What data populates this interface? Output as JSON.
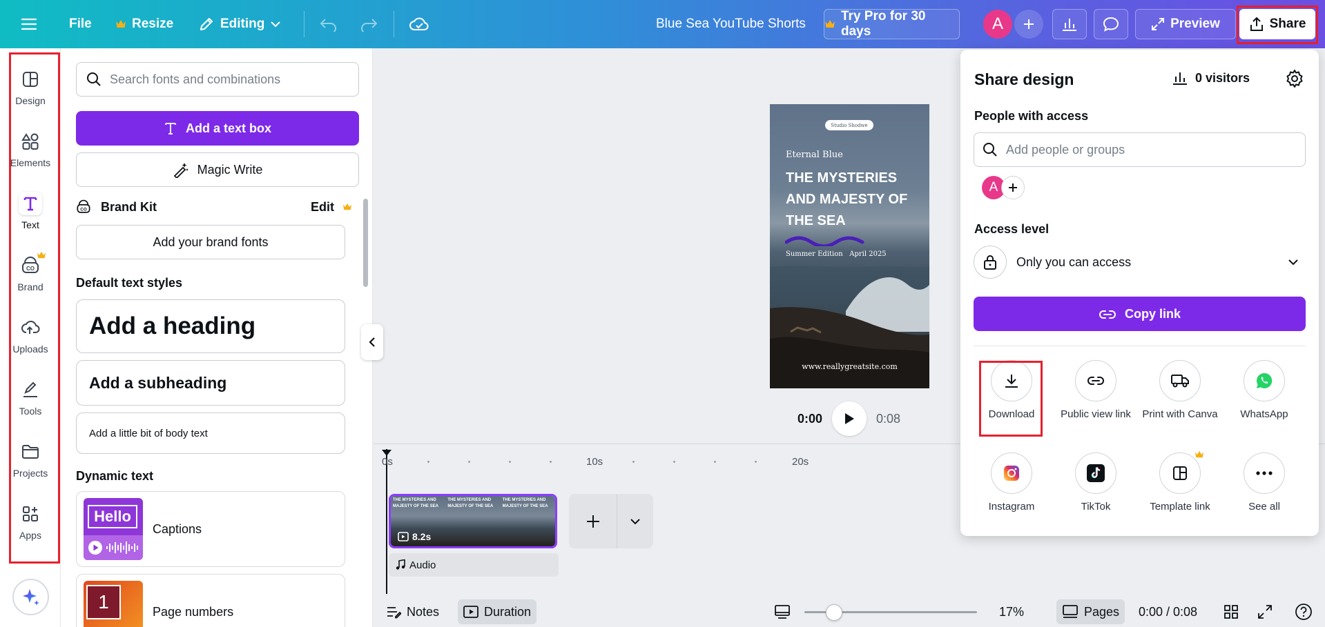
{
  "topbar": {
    "file": "File",
    "resize": "Resize",
    "editing": "Editing",
    "title": "Blue Sea YouTube Shorts",
    "try_pro": "Try Pro for 30 days",
    "avatar_letter": "A",
    "preview": "Preview",
    "share": "Share"
  },
  "rail": {
    "items": [
      {
        "label": "Design",
        "icon": "layout-icon"
      },
      {
        "label": "Elements",
        "icon": "shapes-icon"
      },
      {
        "label": "Text",
        "icon": "text-icon"
      },
      {
        "label": "Brand",
        "icon": "brand-icon"
      },
      {
        "label": "Uploads",
        "icon": "cloud-upload-icon"
      },
      {
        "label": "Tools",
        "icon": "pen-icon"
      },
      {
        "label": "Projects",
        "icon": "folder-icon"
      },
      {
        "label": "Apps",
        "icon": "apps-icon"
      }
    ],
    "active": "Text"
  },
  "panel": {
    "search_placeholder": "Search fonts and combinations",
    "add_text_box": "Add a text box",
    "magic_write": "Magic Write",
    "brand_kit": "Brand Kit",
    "brand_edit": "Edit",
    "add_brand_fonts": "Add your brand fonts",
    "default_styles_title": "Default text styles",
    "heading": "Add a heading",
    "subheading": "Add a subheading",
    "body": "Add a little bit of body text",
    "dynamic_title": "Dynamic text",
    "dynamic": [
      {
        "label": "Captions",
        "thumb_text": "Hello"
      },
      {
        "label": "Page numbers",
        "thumb_text": "1"
      }
    ]
  },
  "design": {
    "studio": "Studio Shodwe",
    "eyebrow": "Eternal Blue",
    "headline": "THE MYSTERIES AND MAJESTY OF THE SEA",
    "edition": "Summer Edition   April 2025",
    "url": "www.reallygreatsite.com"
  },
  "player": {
    "current": "0:00",
    "total": "0:08"
  },
  "timeline": {
    "ticks": [
      "0s",
      "10s",
      "20s"
    ],
    "clip_duration": "8.2s",
    "clip_frame_text": "THE MYSTERIES AND MAJESTY OF THE SEA",
    "audio": "Audio"
  },
  "bottombar": {
    "notes": "Notes",
    "duration": "Duration",
    "zoom": "17%",
    "pages": "Pages",
    "time": "0:00 / 0:08",
    "zoom_level": 0.17
  },
  "share": {
    "title": "Share design",
    "visitors": "0 visitors",
    "people_label": "People with access",
    "people_placeholder": "Add people or groups",
    "avatar_letter": "A",
    "access_label": "Access level",
    "access_value": "Only you can access",
    "copy_link": "Copy link",
    "options": [
      {
        "label": "Download",
        "icon": "download-icon"
      },
      {
        "label": "Public view link",
        "icon": "link-icon"
      },
      {
        "label": "Print with Canva",
        "icon": "truck-icon"
      },
      {
        "label": "WhatsApp",
        "icon": "whatsapp-icon"
      },
      {
        "label": "Instagram",
        "icon": "instagram-icon"
      },
      {
        "label": "TikTok",
        "icon": "tiktok-icon"
      },
      {
        "label": "Template link",
        "icon": "template-icon"
      },
      {
        "label": "See all",
        "icon": "more-icon"
      }
    ]
  },
  "colors": {
    "accent_purple": "#7d2ae8",
    "highlight_red": "#e5212f",
    "crown_gold": "#f5b014"
  }
}
